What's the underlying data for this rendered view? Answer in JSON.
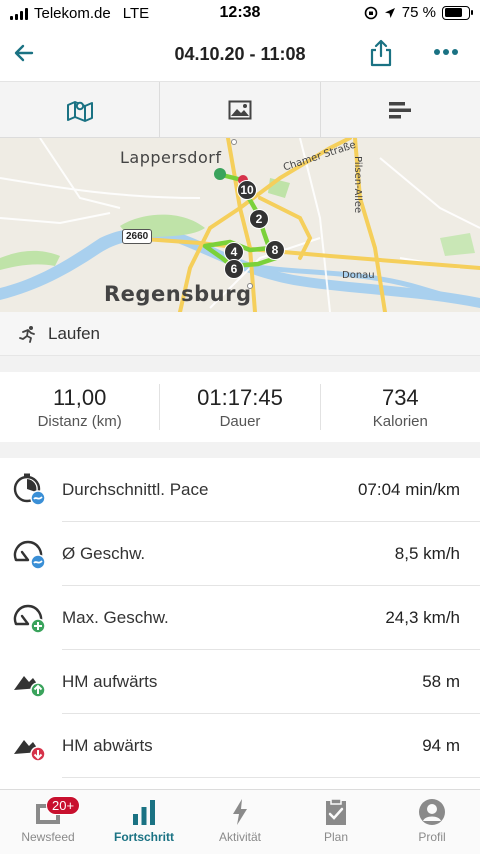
{
  "status_bar": {
    "carrier": "Telekom.de",
    "network": "LTE",
    "time": "12:38",
    "battery": "75 %",
    "battery_level": 0.75
  },
  "nav": {
    "title": "04.10.20 - 11:08",
    "back_icon": "arrow-left-icon",
    "share_icon": "share-icon",
    "more_icon": "more-dots-icon"
  },
  "segments": [
    {
      "icon": "map-icon",
      "active": true
    },
    {
      "icon": "image-icon",
      "active": false
    },
    {
      "icon": "chart-bars-icon",
      "active": false
    }
  ],
  "map": {
    "labels": {
      "lappersdorf": "Lappersdorf",
      "regensburg": "Regensburg",
      "chamer": "Chamer Straße",
      "pilsen": "Pilsen-Allee",
      "donau": "Donau",
      "road": "2660"
    },
    "markers": [
      "10",
      "2",
      "4",
      "8",
      "6"
    ]
  },
  "activity": {
    "icon": "running-icon",
    "label": "Laufen"
  },
  "summary": [
    {
      "value": "11,00",
      "label": "Distanz (km)"
    },
    {
      "value": "01:17:45",
      "label": "Dauer"
    },
    {
      "value": "734",
      "label": "Kalorien"
    }
  ],
  "metrics": [
    {
      "icon": "pace-icon",
      "label": "Durchschnittl. Pace",
      "value": "07:04 min/km"
    },
    {
      "icon": "avg-speed-icon",
      "label": "Ø Geschw.",
      "value": "8,5 km/h"
    },
    {
      "icon": "max-speed-icon",
      "label": "Max. Geschw.",
      "value": "24,3 km/h"
    },
    {
      "icon": "elevation-up-icon",
      "label": "HM aufwärts",
      "value": "58 m"
    },
    {
      "icon": "elevation-down-icon",
      "label": "HM abwärts",
      "value": "94 m"
    }
  ],
  "tabbar": {
    "badge": "20+",
    "tabs": [
      {
        "label": "Newsfeed",
        "icon": "newsfeed-icon",
        "active": false
      },
      {
        "label": "Fortschritt",
        "icon": "progress-bars-icon",
        "active": true
      },
      {
        "label": "Aktivität",
        "icon": "lightning-icon",
        "active": false
      },
      {
        "label": "Plan",
        "icon": "clipboard-icon",
        "active": false
      },
      {
        "label": "Profil",
        "icon": "profile-icon",
        "active": false
      }
    ]
  },
  "colors": {
    "accent": "#1a7283",
    "route": "#7bd13a",
    "badge": "#c8102e",
    "pace_blue": "#3a8fd6",
    "plus_green": "#3aa35c",
    "minus_red": "#d6334a"
  }
}
